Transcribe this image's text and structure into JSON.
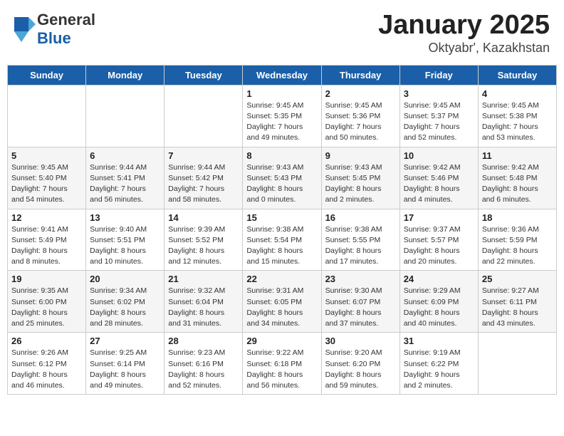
{
  "header": {
    "logo_general": "General",
    "logo_blue": "Blue",
    "month_year": "January 2025",
    "location": "Oktyabr', Kazakhstan"
  },
  "days_of_week": [
    "Sunday",
    "Monday",
    "Tuesday",
    "Wednesday",
    "Thursday",
    "Friday",
    "Saturday"
  ],
  "weeks": [
    [
      {
        "day": "",
        "info": ""
      },
      {
        "day": "",
        "info": ""
      },
      {
        "day": "",
        "info": ""
      },
      {
        "day": "1",
        "info": "Sunrise: 9:45 AM\nSunset: 5:35 PM\nDaylight: 7 hours and 49 minutes."
      },
      {
        "day": "2",
        "info": "Sunrise: 9:45 AM\nSunset: 5:36 PM\nDaylight: 7 hours and 50 minutes."
      },
      {
        "day": "3",
        "info": "Sunrise: 9:45 AM\nSunset: 5:37 PM\nDaylight: 7 hours and 52 minutes."
      },
      {
        "day": "4",
        "info": "Sunrise: 9:45 AM\nSunset: 5:38 PM\nDaylight: 7 hours and 53 minutes."
      }
    ],
    [
      {
        "day": "5",
        "info": "Sunrise: 9:45 AM\nSunset: 5:40 PM\nDaylight: 7 hours and 54 minutes."
      },
      {
        "day": "6",
        "info": "Sunrise: 9:44 AM\nSunset: 5:41 PM\nDaylight: 7 hours and 56 minutes."
      },
      {
        "day": "7",
        "info": "Sunrise: 9:44 AM\nSunset: 5:42 PM\nDaylight: 7 hours and 58 minutes."
      },
      {
        "day": "8",
        "info": "Sunrise: 9:43 AM\nSunset: 5:43 PM\nDaylight: 8 hours and 0 minutes."
      },
      {
        "day": "9",
        "info": "Sunrise: 9:43 AM\nSunset: 5:45 PM\nDaylight: 8 hours and 2 minutes."
      },
      {
        "day": "10",
        "info": "Sunrise: 9:42 AM\nSunset: 5:46 PM\nDaylight: 8 hours and 4 minutes."
      },
      {
        "day": "11",
        "info": "Sunrise: 9:42 AM\nSunset: 5:48 PM\nDaylight: 8 hours and 6 minutes."
      }
    ],
    [
      {
        "day": "12",
        "info": "Sunrise: 9:41 AM\nSunset: 5:49 PM\nDaylight: 8 hours and 8 minutes."
      },
      {
        "day": "13",
        "info": "Sunrise: 9:40 AM\nSunset: 5:51 PM\nDaylight: 8 hours and 10 minutes."
      },
      {
        "day": "14",
        "info": "Sunrise: 9:39 AM\nSunset: 5:52 PM\nDaylight: 8 hours and 12 minutes."
      },
      {
        "day": "15",
        "info": "Sunrise: 9:38 AM\nSunset: 5:54 PM\nDaylight: 8 hours and 15 minutes."
      },
      {
        "day": "16",
        "info": "Sunrise: 9:38 AM\nSunset: 5:55 PM\nDaylight: 8 hours and 17 minutes."
      },
      {
        "day": "17",
        "info": "Sunrise: 9:37 AM\nSunset: 5:57 PM\nDaylight: 8 hours and 20 minutes."
      },
      {
        "day": "18",
        "info": "Sunrise: 9:36 AM\nSunset: 5:59 PM\nDaylight: 8 hours and 22 minutes."
      }
    ],
    [
      {
        "day": "19",
        "info": "Sunrise: 9:35 AM\nSunset: 6:00 PM\nDaylight: 8 hours and 25 minutes."
      },
      {
        "day": "20",
        "info": "Sunrise: 9:34 AM\nSunset: 6:02 PM\nDaylight: 8 hours and 28 minutes."
      },
      {
        "day": "21",
        "info": "Sunrise: 9:32 AM\nSunset: 6:04 PM\nDaylight: 8 hours and 31 minutes."
      },
      {
        "day": "22",
        "info": "Sunrise: 9:31 AM\nSunset: 6:05 PM\nDaylight: 8 hours and 34 minutes."
      },
      {
        "day": "23",
        "info": "Sunrise: 9:30 AM\nSunset: 6:07 PM\nDaylight: 8 hours and 37 minutes."
      },
      {
        "day": "24",
        "info": "Sunrise: 9:29 AM\nSunset: 6:09 PM\nDaylight: 8 hours and 40 minutes."
      },
      {
        "day": "25",
        "info": "Sunrise: 9:27 AM\nSunset: 6:11 PM\nDaylight: 8 hours and 43 minutes."
      }
    ],
    [
      {
        "day": "26",
        "info": "Sunrise: 9:26 AM\nSunset: 6:12 PM\nDaylight: 8 hours and 46 minutes."
      },
      {
        "day": "27",
        "info": "Sunrise: 9:25 AM\nSunset: 6:14 PM\nDaylight: 8 hours and 49 minutes."
      },
      {
        "day": "28",
        "info": "Sunrise: 9:23 AM\nSunset: 6:16 PM\nDaylight: 8 hours and 52 minutes."
      },
      {
        "day": "29",
        "info": "Sunrise: 9:22 AM\nSunset: 6:18 PM\nDaylight: 8 hours and 56 minutes."
      },
      {
        "day": "30",
        "info": "Sunrise: 9:20 AM\nSunset: 6:20 PM\nDaylight: 8 hours and 59 minutes."
      },
      {
        "day": "31",
        "info": "Sunrise: 9:19 AM\nSunset: 6:22 PM\nDaylight: 9 hours and 2 minutes."
      },
      {
        "day": "",
        "info": ""
      }
    ]
  ]
}
